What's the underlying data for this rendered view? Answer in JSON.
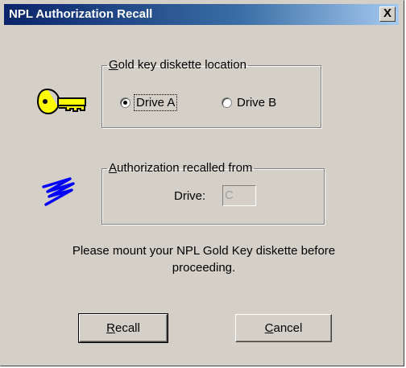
{
  "window": {
    "title": "NPL Authorization Recall",
    "close_glyph": "X"
  },
  "gold_key_group": {
    "legend_access": "G",
    "legend_rest": "old key diskette location",
    "options": [
      {
        "label": "Drive A",
        "selected": true
      },
      {
        "label": "Drive B",
        "selected": false
      }
    ]
  },
  "auth_group": {
    "legend_access": "A",
    "legend_rest": "uthorization recalled from",
    "drive_label": "Drive:",
    "drive_value": "C"
  },
  "message": {
    "line1": "Please mount your NPL Gold Key diskette before",
    "line2": "proceeding."
  },
  "buttons": {
    "recall_access": "R",
    "recall_rest": "ecall",
    "cancel_access": "C",
    "cancel_rest": "ancel"
  },
  "icons": {
    "key": "key-icon",
    "authorization": "signature-scribble-icon"
  },
  "colors": {
    "title_start": "#0a246a",
    "key": "#ffff00",
    "scribble": "#0000ff",
    "face": "#d4d0c8"
  }
}
